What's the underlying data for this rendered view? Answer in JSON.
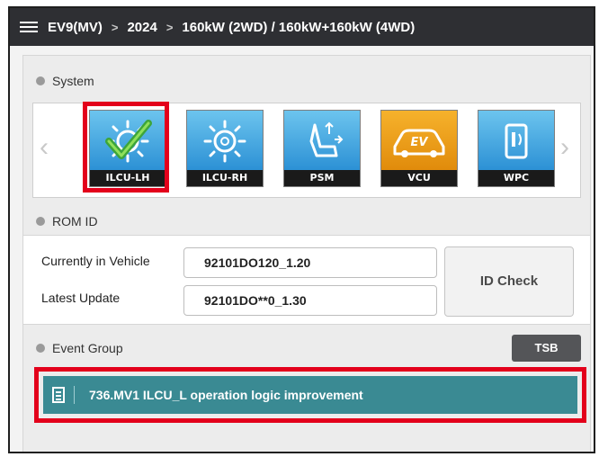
{
  "breadcrumb": {
    "model": "EV9(MV)",
    "separator": ">",
    "year": "2024",
    "variant": "160kW (2WD) / 160kW+160kW (4WD)"
  },
  "system": {
    "title": "System",
    "tiles": [
      {
        "label": "ILCU-LH",
        "icon": "light-check-icon",
        "selected": true
      },
      {
        "label": "ILCU-RH",
        "icon": "light-icon",
        "selected": false
      },
      {
        "label": "PSM",
        "icon": "seat-icon",
        "selected": false
      },
      {
        "label": "VCU",
        "icon": "ev-car-icon",
        "selected": false
      },
      {
        "label": "WPC",
        "icon": "wireless-charging-icon",
        "selected": false
      }
    ]
  },
  "rom": {
    "title": "ROM ID",
    "current_label": "Currently in Vehicle",
    "current_value": "92101DO120_1.20",
    "latest_label": "Latest Update",
    "latest_value": "92101DO**0_1.30",
    "id_check_label": "ID Check"
  },
  "event": {
    "title": "Event Group",
    "tsb_label": "TSB",
    "items": [
      {
        "text": "736.MV1 ILCU_L operation logic improvement"
      }
    ]
  },
  "colors": {
    "highlight": "#e3001b",
    "event_row": "#3a8a93",
    "tile_blue": "#2a8fd4",
    "tile_orange": "#f3a31b",
    "topbar": "#2e2f33"
  }
}
